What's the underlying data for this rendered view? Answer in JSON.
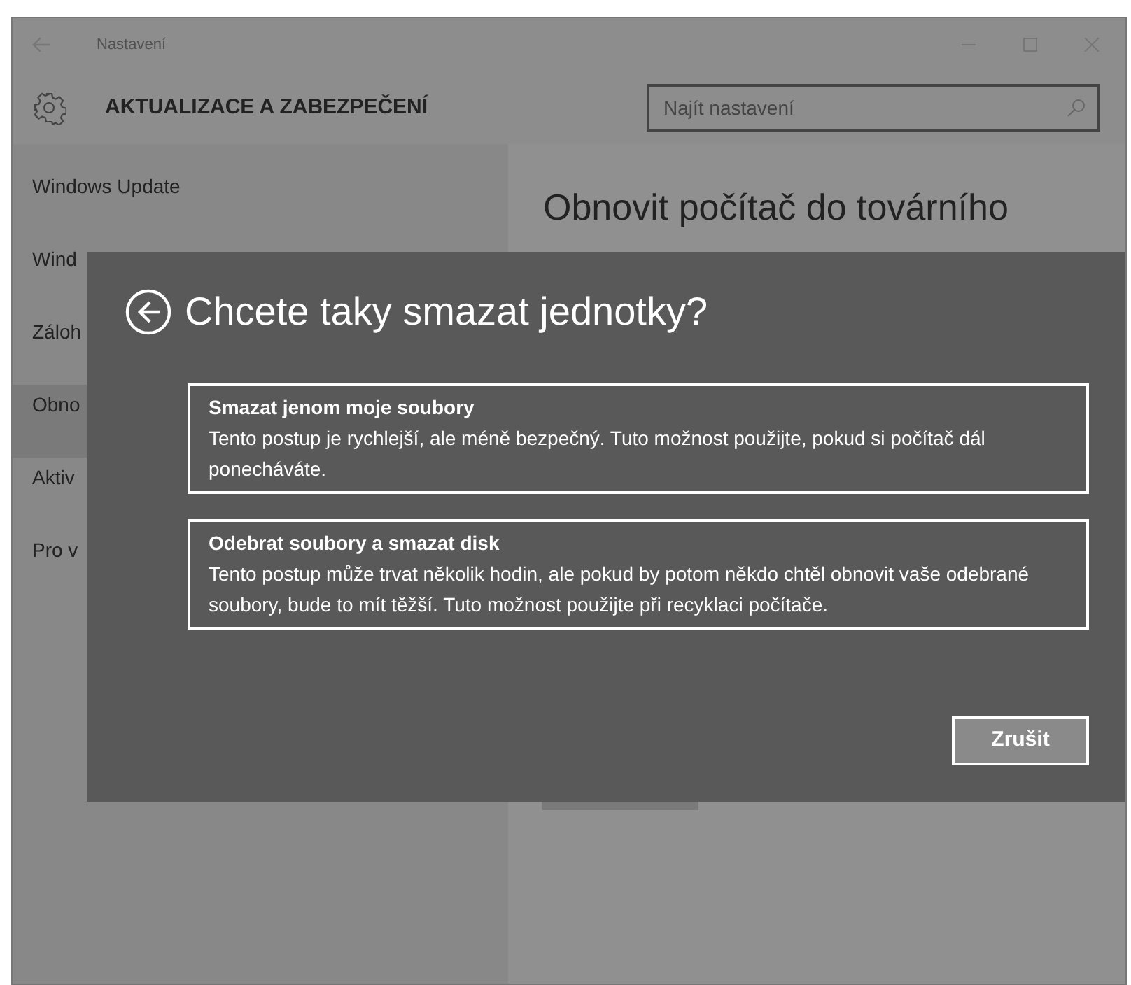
{
  "window": {
    "title": "Nastavení"
  },
  "header": {
    "title": "AKTUALIZACE A ZABEZPEČENÍ",
    "search": {
      "placeholder": "Najít nastavení"
    }
  },
  "sidebar": {
    "items": [
      {
        "label": "Windows Update",
        "selected": false
      },
      {
        "label": "Wind",
        "selected": false
      },
      {
        "label": "Záloh",
        "selected": false
      },
      {
        "label": "Obno",
        "selected": true
      },
      {
        "label": "Aktiv",
        "selected": false
      },
      {
        "label": "Pro v",
        "selected": false
      }
    ]
  },
  "content": {
    "heading": "Obnovit počítač do továrního"
  },
  "dialog": {
    "title": "Chcete taky smazat jednotky?",
    "options": [
      {
        "title": "Smazat jenom moje soubory",
        "description": "Tento postup je rychlejší, ale méně bezpečný. Tuto možnost použijte, pokud si počítač dál ponecháváte."
      },
      {
        "title": "Odebrat soubory a smazat disk",
        "description": "Tento postup může trvat několik hodin, ale pokud by potom někdo chtěl obnovit vaše odebrané soubory, bude to mít těžší. Tuto možnost použijte při recyklaci počítače."
      }
    ],
    "cancel": "Zrušit"
  }
}
